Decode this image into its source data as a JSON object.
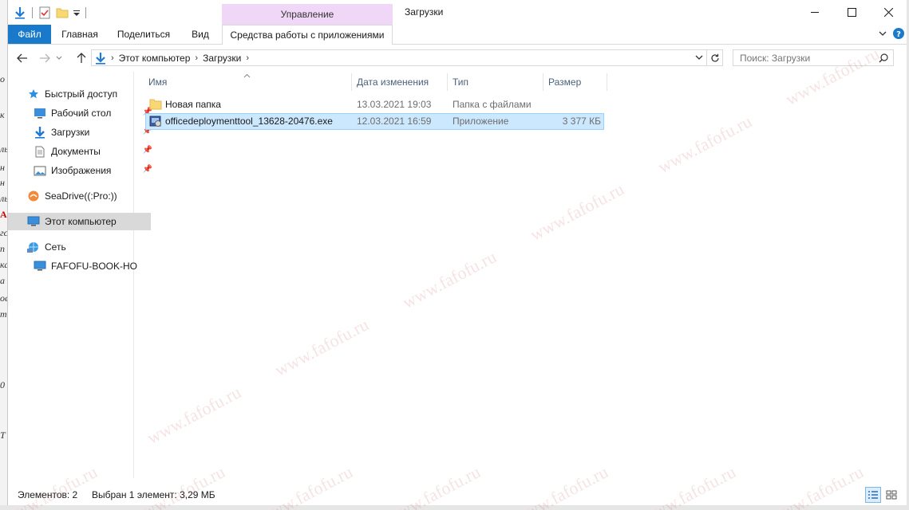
{
  "background_window": {
    "fragments": [
      "о",
      "к",
      "ль",
      "н",
      "н",
      "ль",
      "А",
      "гс",
      "п",
      "ка",
      "а",
      "ое",
      "т",
      "0",
      "Т"
    ]
  },
  "title_bar": {
    "window_title": "Загрузки",
    "context_tab_label": "Управление"
  },
  "ribbon": {
    "tabs": [
      {
        "label": "Файл"
      },
      {
        "label": "Главная"
      },
      {
        "label": "Поделиться"
      },
      {
        "label": "Вид"
      }
    ],
    "context_tab": "Средства работы с приложениями"
  },
  "address_bar": {
    "breadcrumbs": [
      "Этот компьютер",
      "Загрузки"
    ]
  },
  "search": {
    "placeholder": "Поиск: Загрузки"
  },
  "nav_pane": {
    "items": [
      {
        "label": "Быстрый доступ",
        "icon": "star-icon"
      },
      {
        "label": "Рабочий стол",
        "icon": "desktop-folder-icon",
        "pinned": true
      },
      {
        "label": "Загрузки",
        "icon": "downloads-icon",
        "pinned": true
      },
      {
        "label": "Документы",
        "icon": "documents-icon",
        "pinned": true
      },
      {
        "label": "Изображения",
        "icon": "pictures-icon",
        "pinned": true
      },
      {
        "label": "SeaDrive((:Pro:))",
        "icon": "seadrive-icon"
      },
      {
        "label": "Этот компьютер",
        "icon": "computer-icon",
        "selected": true
      },
      {
        "label": "Сеть",
        "icon": "network-icon"
      },
      {
        "label": "FAFOFU-BOOK-HO",
        "icon": "computer-icon"
      }
    ]
  },
  "file_list": {
    "columns": [
      "Имя",
      "Дата изменения",
      "Тип",
      "Размер"
    ],
    "rows": [
      {
        "name": "Новая папка",
        "date": "13.03.2021 19:03",
        "type": "Папка с файлами",
        "size": "",
        "icon": "folder-icon"
      },
      {
        "name": "officedeploymenttool_13628-20476.exe",
        "date": "12.03.2021 16:59",
        "type": "Приложение",
        "size": "3 377 КБ",
        "icon": "exe-icon",
        "selected": true
      }
    ]
  },
  "status_bar": {
    "items_count": "Элементов: 2",
    "selection": "Выбран 1 элемент: 3,29 МБ"
  },
  "watermark": {
    "text": "www.fafofu.ru"
  },
  "colors": {
    "accent": "#1979ca",
    "context_tab": "#f1d7f7",
    "selection": "#cce8ff",
    "column_header_text": "#4c607a"
  }
}
